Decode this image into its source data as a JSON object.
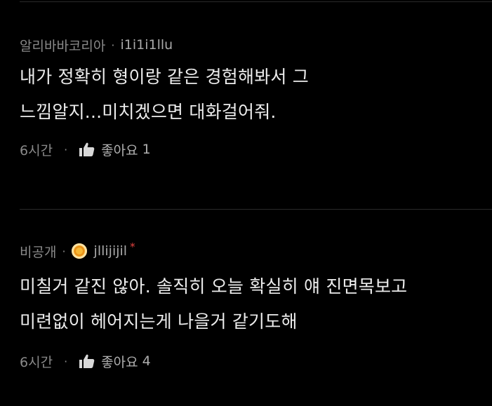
{
  "comments": [
    {
      "author": "알리바바코리아",
      "user_id": "i1i1i1llu",
      "text_lines": [
        "내가 정확히 형이랑 같은 경험해봐서 그",
        "느낌알지...미치겠으면 대화걸어줘."
      ],
      "time": "6시간",
      "like_label": "좋아요",
      "like_count": "1",
      "separator": "·"
    },
    {
      "author": "비공개",
      "user_id": "jllijijil",
      "star": "*",
      "text_lines": [
        "미칠거 같진 않아. 솔직히 오늘 확실히 얘 진면목보고",
        "미련없이 헤어지는게 나을거 같기도해"
      ],
      "time": "6시간",
      "like_label": "좋아요",
      "like_count": "4",
      "separator": "·"
    }
  ],
  "colors": {
    "background": "#000000",
    "text": "#ececec",
    "meta": "#8a8a8a",
    "badge": "#f5a623",
    "star": "#e0413f",
    "divider": "#2a2a2a"
  },
  "icons": {
    "like": "thumbs-up-icon",
    "badge": "level-badge-icon"
  }
}
